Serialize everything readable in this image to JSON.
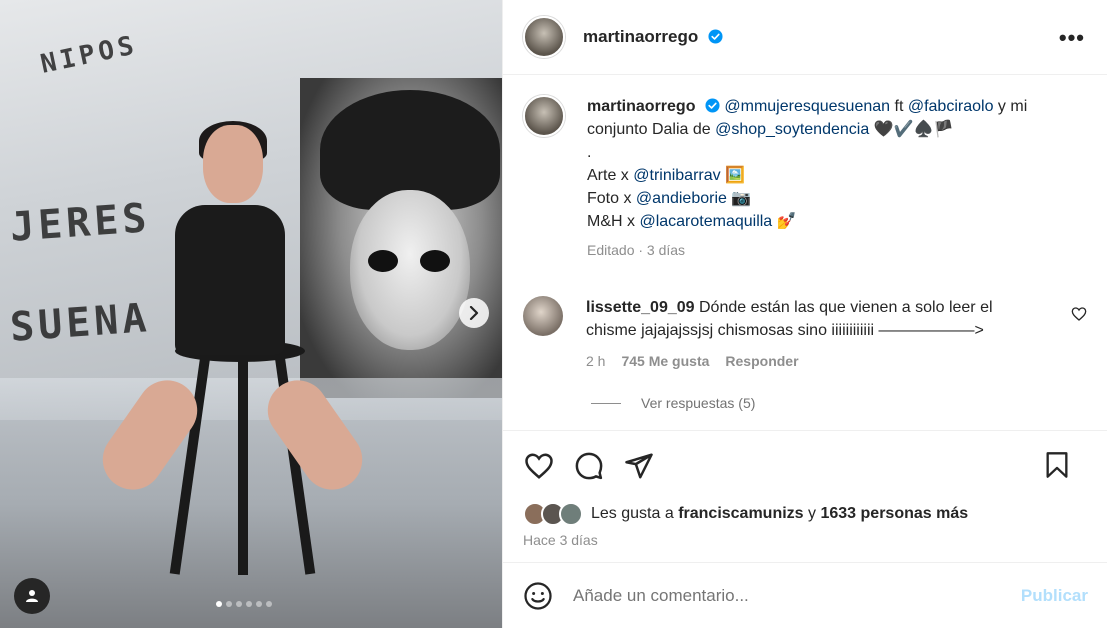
{
  "post": {
    "image_dots": 6,
    "active_dot": 0
  },
  "header": {
    "username": "martinaorrego",
    "more_label": "•••"
  },
  "caption": {
    "username": "martinaorrego",
    "mention1": "@mmujeresquesuenan",
    "ft": "ft",
    "mention2": "@fabciraolo",
    "text1": "y mi conjunto Dalia de",
    "mention3": "@shop_soytendencia",
    "emojis1": "🖤✔️♠️🏴",
    "dot": ".",
    "line_arte_prefix": "Arte x",
    "line_arte_mention": "@trinibarrav",
    "line_arte_emoji": "🖼️",
    "line_foto_prefix": "Foto x",
    "line_foto_mention": "@andieborie",
    "line_foto_emoji": "📷",
    "line_mh_prefix": "M&H x",
    "line_mh_mention": "@lacarotemaquilla",
    "line_mh_emoji": "💅",
    "meta": "Editado · 3 días"
  },
  "comment": {
    "username": "lissette_09_09",
    "text": "Dónde están las que vienen a solo leer el chisme jajajajssjsj chismosas sino iiiiiiiiiiii ——————>",
    "time": "2 h",
    "likes": "745 Me gusta",
    "reply": "Responder",
    "view_replies": "Ver respuestas (5)"
  },
  "likes": {
    "prefix": "Les gusta a",
    "user": "franciscamunizs",
    "conj": "y",
    "others": "1633 personas más"
  },
  "date": "Hace 3 días",
  "add_comment": {
    "placeholder": "Añade un comentario...",
    "post_label": "Publicar"
  },
  "colors": {
    "link": "#00376b",
    "verified": "#0095f6",
    "post_disabled": "#b2dffc"
  }
}
